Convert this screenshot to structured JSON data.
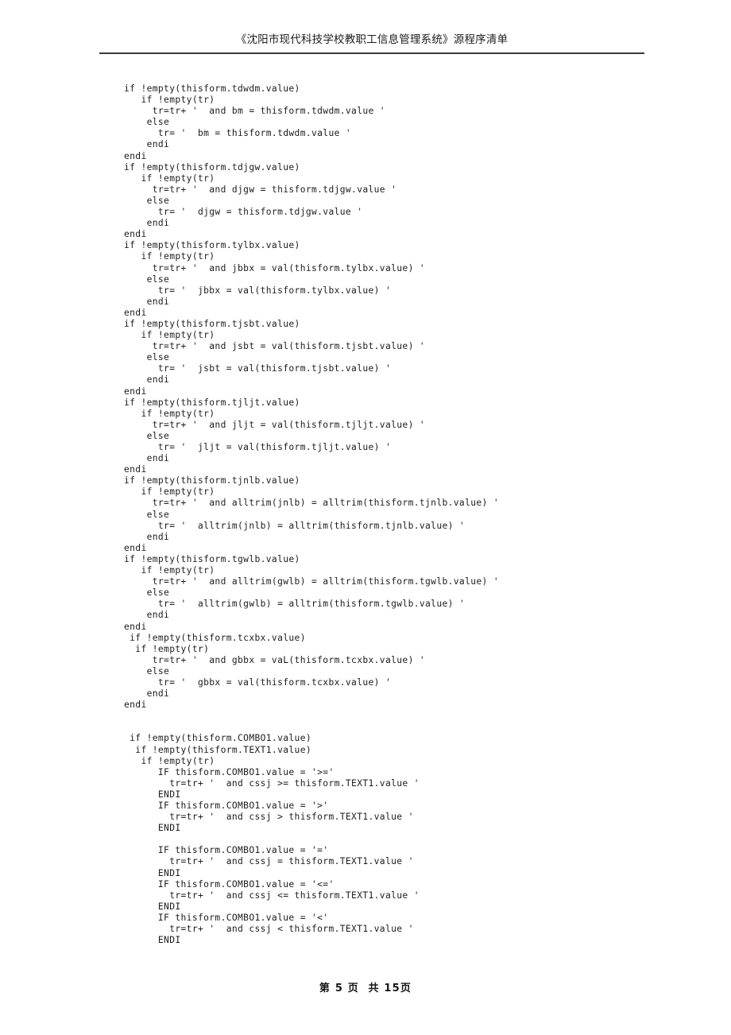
{
  "document": {
    "header": {
      "title": "《沈阳市现代科技学校教职工信息管理系统》源程序清单"
    },
    "footer": {
      "page_label": "第 5 页  共 15页",
      "current_page": 5,
      "total_pages": 15
    },
    "code": {
      "language": "Visual FoxPro",
      "lines": [
        "if !empty(thisform.tdwdm.value)",
        "   if !empty(tr)",
        "     tr=tr+ '  and bm = thisform.tdwdm.value '",
        "    else",
        "      tr= '  bm = thisform.tdwdm.value '",
        "    endi",
        "endi",
        "if !empty(thisform.tdjgw.value)",
        "   if !empty(tr)",
        "     tr=tr+ '  and djgw = thisform.tdjgw.value '",
        "    else",
        "      tr= '  djgw = thisform.tdjgw.value '",
        "    endi",
        "endi",
        "if !empty(thisform.tylbx.value)",
        "   if !empty(tr)",
        "     tr=tr+ '  and jbbx = val(thisform.tylbx.value) '",
        "    else",
        "      tr= '  jbbx = val(thisform.tylbx.value) '",
        "    endi",
        "endi",
        "if !empty(thisform.tjsbt.value)",
        "   if !empty(tr)",
        "     tr=tr+ '  and jsbt = val(thisform.tjsbt.value) '",
        "    else",
        "      tr= '  jsbt = val(thisform.tjsbt.value) '",
        "    endi",
        "endi",
        "if !empty(thisform.tjljt.value)",
        "   if !empty(tr)",
        "     tr=tr+ '  and jljt = val(thisform.tjljt.value) '",
        "    else",
        "      tr= '  jljt = val(thisform.tjljt.value) '",
        "    endi",
        "endi",
        "if !empty(thisform.tjnlb.value)",
        "   if !empty(tr)",
        "     tr=tr+ '  and alltrim(jnlb) = alltrim(thisform.tjnlb.value) '",
        "    else",
        "      tr= '  alltrim(jnlb) = alltrim(thisform.tjnlb.value) '",
        "    endi",
        "endi",
        "if !empty(thisform.tgwlb.value)",
        "   if !empty(tr)",
        "     tr=tr+ '  and alltrim(gwlb) = alltrim(thisform.tgwlb.value) '",
        "    else",
        "      tr= '  alltrim(gwlb) = alltrim(thisform.tgwlb.value) '",
        "    endi",
        "endi",
        " if !empty(thisform.tcxbx.value)",
        "  if !empty(tr)",
        "     tr=tr+ '  and gbbx = vaL(thisform.tcxbx.value) '",
        "    else",
        "      tr= '  gbbx = val(thisform.tcxbx.value) '",
        "    endi",
        "endi",
        "",
        "",
        " if !empty(thisform.COMBO1.value)",
        "  if !empty(thisform.TEXT1.value)",
        "   if !empty(tr)",
        "      IF thisform.COMBO1.value = '>='",
        "        tr=tr+ '  and cssj >= thisform.TEXT1.value '",
        "      ENDI",
        "      IF thisform.COMBO1.value = '>'",
        "        tr=tr+ '  and cssj > thisform.TEXT1.value '",
        "      ENDI",
        "",
        "      IF thisform.COMBO1.value = '='",
        "        tr=tr+ '  and cssj = thisform.TEXT1.value '",
        "      ENDI",
        "      IF thisform.COMBO1.value = '<='",
        "        tr=tr+ '  and cssj <= thisform.TEXT1.value '",
        "      ENDI",
        "      IF thisform.COMBO1.value = '<'",
        "        tr=tr+ '  and cssj < thisform.TEXT1.value '",
        "      ENDI"
      ]
    }
  }
}
